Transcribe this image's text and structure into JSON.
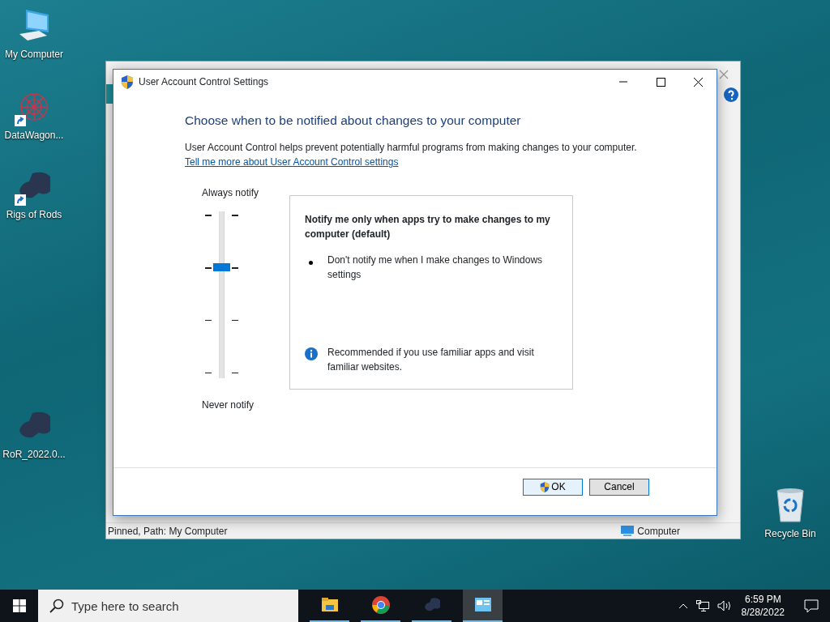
{
  "desktop_icons": [
    {
      "label": "My Computer",
      "kind": "computer",
      "shortcut": false
    },
    {
      "label": "DataWagon...",
      "kind": "network",
      "shortcut": true
    },
    {
      "label": "Rigs of Rods",
      "kind": "truck",
      "shortcut": true
    },
    {
      "label": "RoR_2022.0...",
      "kind": "truck",
      "shortcut": false
    },
    {
      "label": "Recycle Bin",
      "kind": "bin",
      "shortcut": false
    }
  ],
  "background_window": {
    "status_text": "Pinned, Path: My Computer",
    "status_location": "Computer"
  },
  "dialog": {
    "title": "User Account Control Settings",
    "heading": "Choose when to be notified about changes to your computer",
    "description": "User Account Control helps prevent potentially harmful programs from making changes to your computer.",
    "help_link": "Tell me more about User Account Control settings",
    "slider": {
      "top_label": "Always notify",
      "bottom_label": "Never notify",
      "level": 0.667
    },
    "info_box": {
      "title": "Notify me only when apps try to make changes to my computer (default)",
      "bullets": [
        "Don't notify me when I make changes to Windows settings"
      ],
      "note": "Recommended if you use familiar apps and visit familiar websites."
    },
    "buttons": [
      {
        "label": "OK",
        "shield": true
      },
      {
        "label": "Cancel",
        "shield": false
      }
    ]
  },
  "taskbar": {
    "search_placeholder": "Type here to search",
    "apps": [
      {
        "kind": "folder",
        "active": false
      },
      {
        "kind": "browser",
        "active": false
      },
      {
        "kind": "truck",
        "active": false
      },
      {
        "kind": "control-panel",
        "active": true
      }
    ],
    "time": "6:59 PM",
    "date": "8/28/2022"
  }
}
